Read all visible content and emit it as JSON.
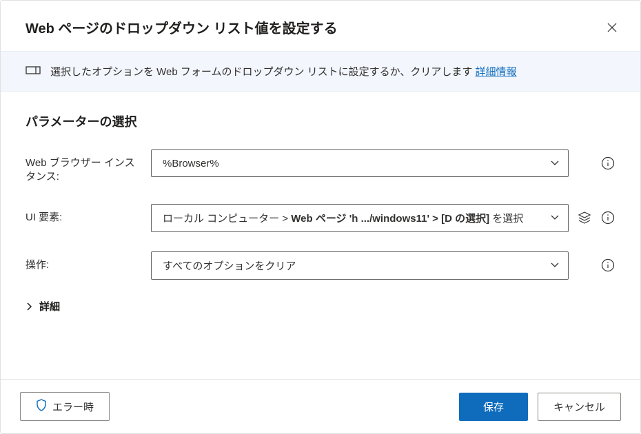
{
  "dialog": {
    "title": "Web ページのドロップダウン リスト値を設定する"
  },
  "banner": {
    "text": "選択したオプションを Web フォームのドロップダウン リストに設定するか、クリアします ",
    "link": "詳細情報"
  },
  "section": {
    "title": "パラメーターの選択"
  },
  "fields": {
    "browser": {
      "label": "Web ブラウザー インスタンス:",
      "value": "%Browser%"
    },
    "uiElement": {
      "label": "UI 要素:",
      "prefix": "ローカル コンピューター > ",
      "bold": "Web ページ 'h .../windows11' > [D の選択]",
      "suffix": " を選択"
    },
    "operation": {
      "label": "操作:",
      "value": "すべてのオプションをクリア"
    }
  },
  "advanced": {
    "label": "詳細"
  },
  "footer": {
    "onError": "エラー時",
    "save": "保存",
    "cancel": "キャンセル"
  }
}
